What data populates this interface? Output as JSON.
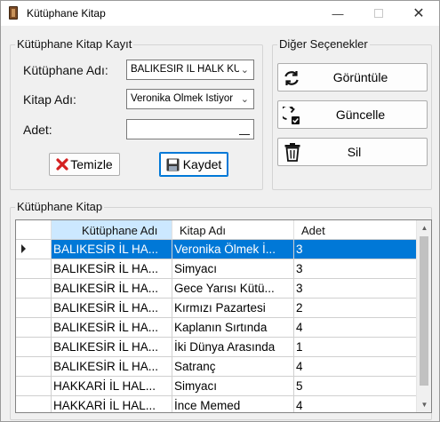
{
  "window": {
    "title": "Kütüphane Kitap",
    "minimize_glyph": "—",
    "close_glyph": "✕"
  },
  "kayit": {
    "legend": "Kütüphane Kitap Kayıt",
    "kutuphane_label": "Kütüphane Adı:",
    "kutuphane_value": "BALIKESİR İL HALK KÜTÜPHANESİ",
    "kitap_label": "Kitap Adı:",
    "kitap_value": "Veronika Ölmek İstiyor",
    "adet_label": "Adet:",
    "adet_value": "",
    "temizle_label": "Temizle",
    "kaydet_label": "Kaydet"
  },
  "diger": {
    "legend": "Diğer Seçenekler",
    "goruntule_label": "Görüntüle",
    "guncelle_label": "Güncelle",
    "sil_label": "Sil"
  },
  "grid_group": {
    "legend": "Kütüphane Kitap"
  },
  "table": {
    "columns": [
      "Kütüphane Adı",
      "Kitap Adı",
      "Adet"
    ],
    "rows": [
      [
        "BALIKESİR İL HA...",
        "Veronika Ölmek İ...",
        "3"
      ],
      [
        "BALIKESİR İL HA...",
        "Simyacı",
        "3"
      ],
      [
        "BALIKESİR İL HA...",
        "Gece Yarısı Kütü...",
        "3"
      ],
      [
        "BALIKESİR İL HA...",
        "Kırmızı Pazartesi",
        "2"
      ],
      [
        "BALIKESİR İL HA...",
        "Kaplanın Sırtında",
        "4"
      ],
      [
        "BALIKESİR İL HA...",
        "İki Dünya Arasında",
        "1"
      ],
      [
        "BALIKESİR İL HA...",
        "Satranç",
        "4"
      ],
      [
        "HAKKARİ İL HAL...",
        "Simyacı",
        "5"
      ],
      [
        "HAKKARİ İL HAL...",
        "İnce Memed",
        "4"
      ]
    ],
    "selected_row": 0
  },
  "colors": {
    "selection": "#0078d7",
    "header_selected": "#cce8ff",
    "grid_background": "#ababab",
    "window_background": "#f0f0f0"
  },
  "icons": {
    "goruntule": "refresh-icon",
    "guncelle": "update-icon",
    "sil": "trash-icon",
    "temizle": "red-x-icon",
    "kaydet": "floppy-disk-icon"
  }
}
